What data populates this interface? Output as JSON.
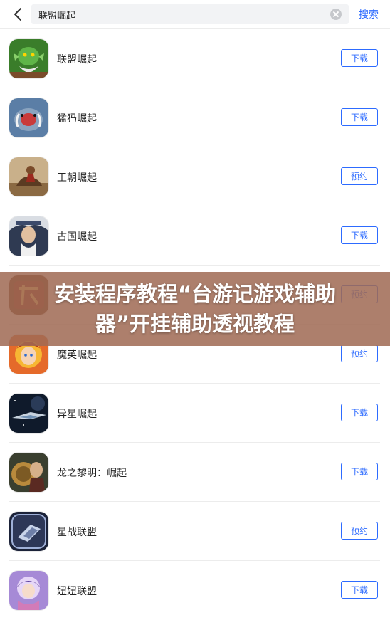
{
  "search": {
    "value": "联盟崛起",
    "button_label": "搜索"
  },
  "icons": {
    "back": "chevron-left-icon",
    "clear": "clear-circle-icon"
  },
  "colors": {
    "accent": "#2d6bff",
    "banner_overlay": "#a06a54"
  },
  "results": [
    {
      "name": "联盟崛起",
      "action": "下载"
    },
    {
      "name": "猛犸崛起",
      "action": "下载"
    },
    {
      "name": "王朝崛起",
      "action": "预约"
    },
    {
      "name": "古国崛起",
      "action": "下载"
    },
    {
      "name": "",
      "action": "预约"
    },
    {
      "name": "魔英崛起",
      "action": "预约"
    },
    {
      "name": "异星崛起",
      "action": "下载"
    },
    {
      "name": "龙之黎明：崛起",
      "action": "下载"
    },
    {
      "name": "星战联盟",
      "action": "预约"
    },
    {
      "name": "妞妞联盟",
      "action": "下载"
    }
  ],
  "overlay_banner": {
    "text": "安装程序教程“台游记游戏辅助器”开挂辅助透视教程"
  }
}
